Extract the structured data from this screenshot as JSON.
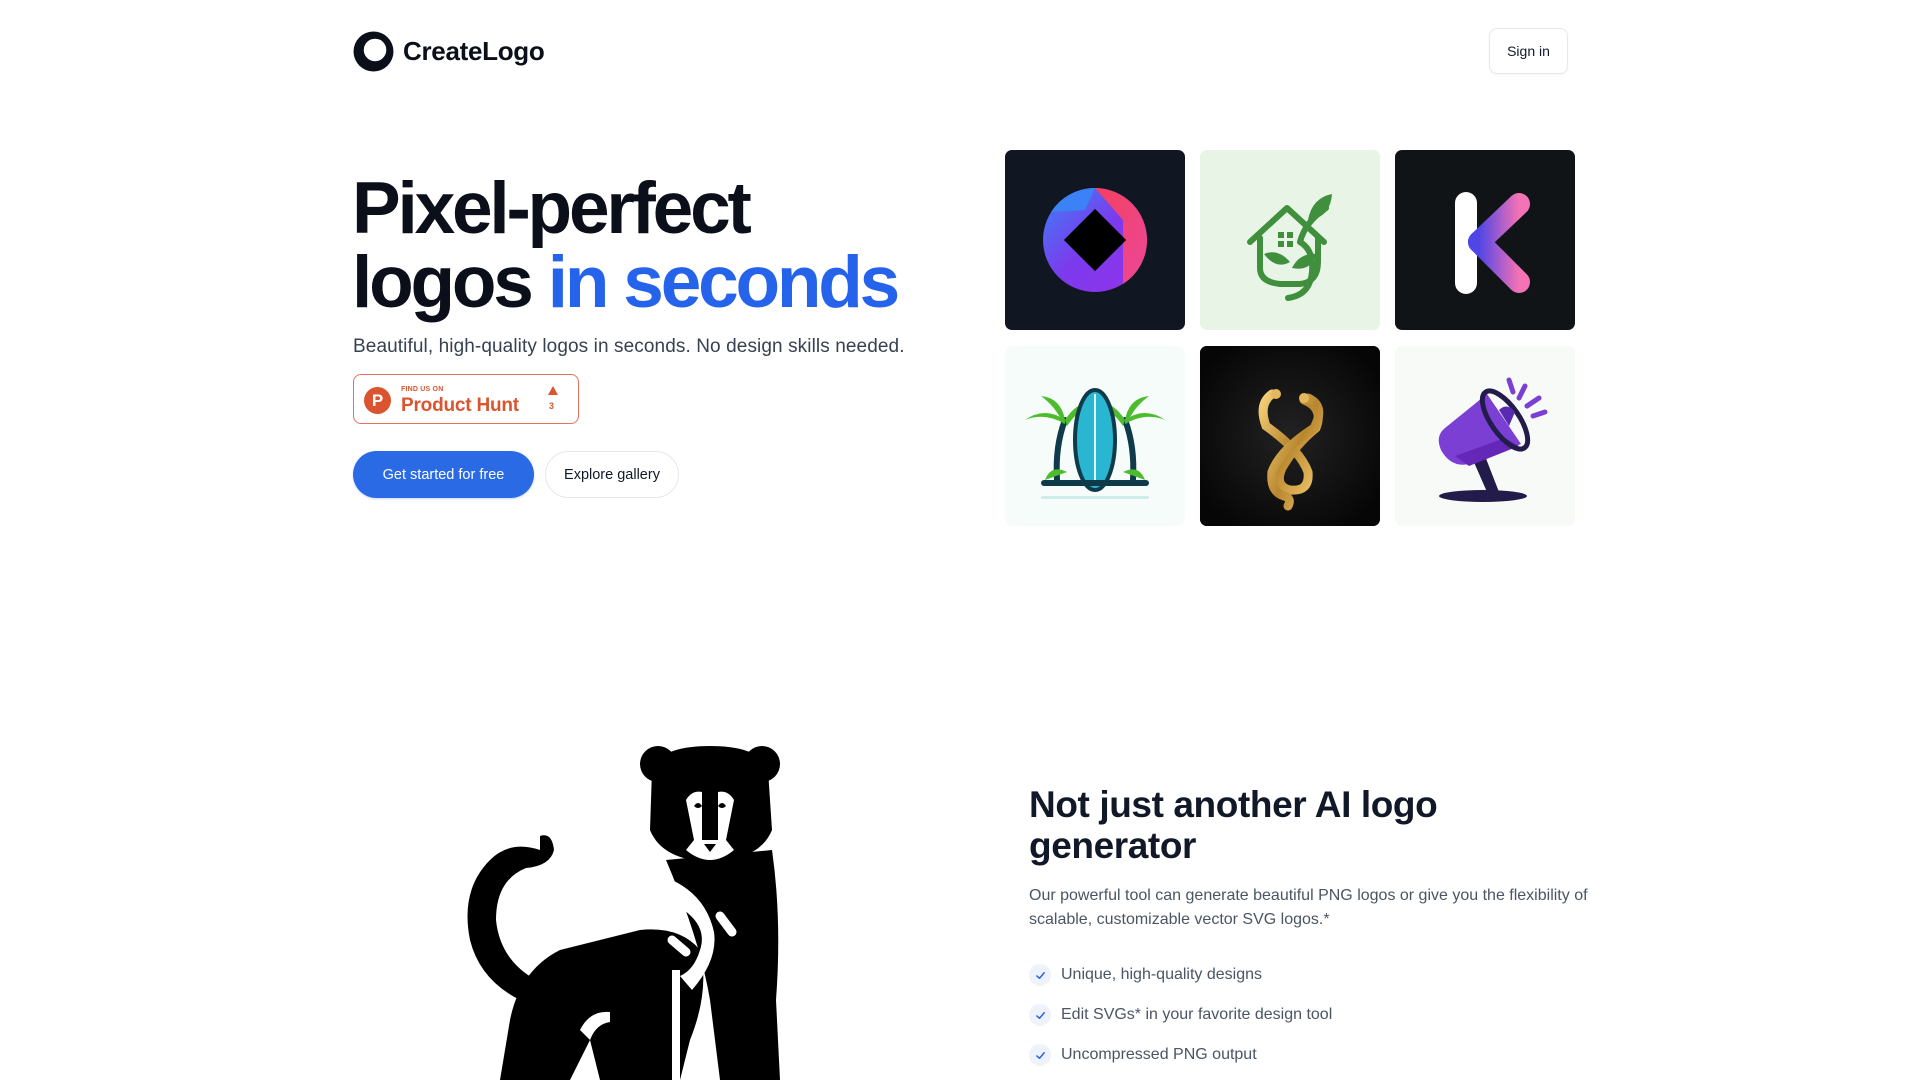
{
  "nav": {
    "brand_name": "CreateLogo",
    "brand_icon": "swirl-ring-logo",
    "signin_label": "Sign in"
  },
  "hero": {
    "title_line1": "Pixel-perfect",
    "title_line2_plain": "logos",
    "title_line2_accent": "in seconds",
    "subtitle": "Beautiful, high-quality logos in seconds. No design skills needed.",
    "accent_color": "#2563eb",
    "product_hunt": {
      "find_label": "FIND US ON",
      "name": "Product Hunt",
      "logo_letter": "P",
      "upvotes": "3",
      "color": "#da552f"
    },
    "primary_cta": "Get started for free",
    "secondary_cta": "Explore gallery"
  },
  "gallery": [
    {
      "name": "gradient-ring-logo",
      "description": "blue-red-purple ring with black diamond",
      "bg": "#101722"
    },
    {
      "name": "green-house-leaf-logo",
      "description": "green house with leaves",
      "bg": "#e8f4e6"
    },
    {
      "name": "gradient-k-logo",
      "description": "letter K white and pink gradient",
      "bg": "#111417"
    },
    {
      "name": "surfboard-palms-logo",
      "description": "surfboard between palm trees",
      "bg": "#f6fcfa"
    },
    {
      "name": "golden-snakes-logo",
      "description": "two intertwined golden snakes",
      "bg": "#0c0c0c"
    },
    {
      "name": "purple-megaphone-logo",
      "description": "purple megaphone on stand",
      "bg": "#f7faf7"
    }
  ],
  "section2": {
    "illustration": "black-panther-logo",
    "title": "Not just another AI logo generator",
    "description": "Our powerful tool can generate beautiful PNG logos or give you the flexibility of scalable, customizable vector SVG logos.*",
    "features": [
      "Unique, high-quality designs",
      "Edit SVGs* in your favorite design tool",
      "Uncompressed PNG output"
    ]
  }
}
